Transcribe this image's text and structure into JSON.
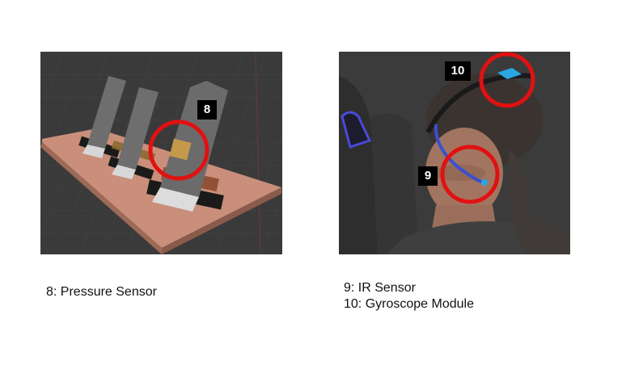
{
  "left_figure": {
    "label_8": "8",
    "caption": "8: Pressure Sensor"
  },
  "right_figure": {
    "label_9": "9",
    "label_10": "10",
    "caption_ir": "9: IR Sensor",
    "caption_gyro": "10: Gyroscope Module"
  },
  "colors": {
    "highlight_ring": "#e11111",
    "viewport_bg": "#3a3a3a",
    "base_plate": "#c98f7a",
    "ir_sensor": "#3a4fd0",
    "gyro_module": "#2aa7e0"
  }
}
